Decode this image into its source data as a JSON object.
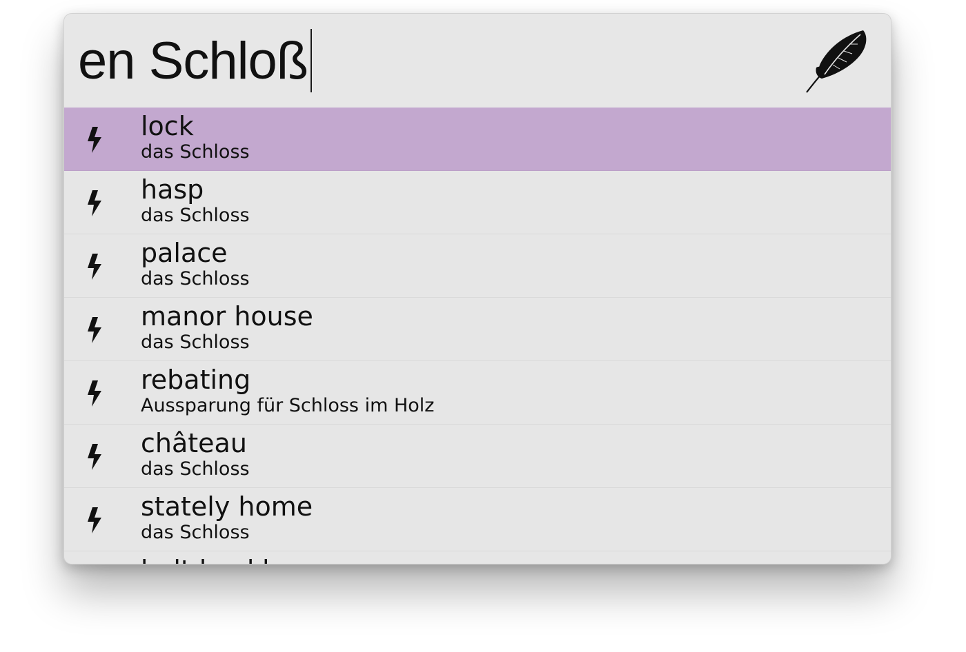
{
  "search": {
    "query": "en Schloß",
    "logo_icon": "feather-icon"
  },
  "results": [
    {
      "title": "lock",
      "subtitle": "das Schloss",
      "icon": "bolt-icon",
      "selected": true
    },
    {
      "title": "hasp",
      "subtitle": "das Schloss",
      "icon": "bolt-icon",
      "selected": false
    },
    {
      "title": "palace",
      "subtitle": "das Schloss",
      "icon": "bolt-icon",
      "selected": false
    },
    {
      "title": "manor house",
      "subtitle": "das Schloss",
      "icon": "bolt-icon",
      "selected": false
    },
    {
      "title": "rebating",
      "subtitle": "Aussparung für Schloss im Holz",
      "icon": "bolt-icon",
      "selected": false
    },
    {
      "title": "château",
      "subtitle": "das Schloss",
      "icon": "bolt-icon",
      "selected": false
    },
    {
      "title": "stately home",
      "subtitle": "das Schloss",
      "icon": "bolt-icon",
      "selected": false
    },
    {
      "title": "bolt buckle",
      "subtitle": "",
      "icon": "bolt-icon",
      "selected": false
    }
  ],
  "colors": {
    "selected_row": "#c3a8cf",
    "background": "#e6e6e6"
  }
}
